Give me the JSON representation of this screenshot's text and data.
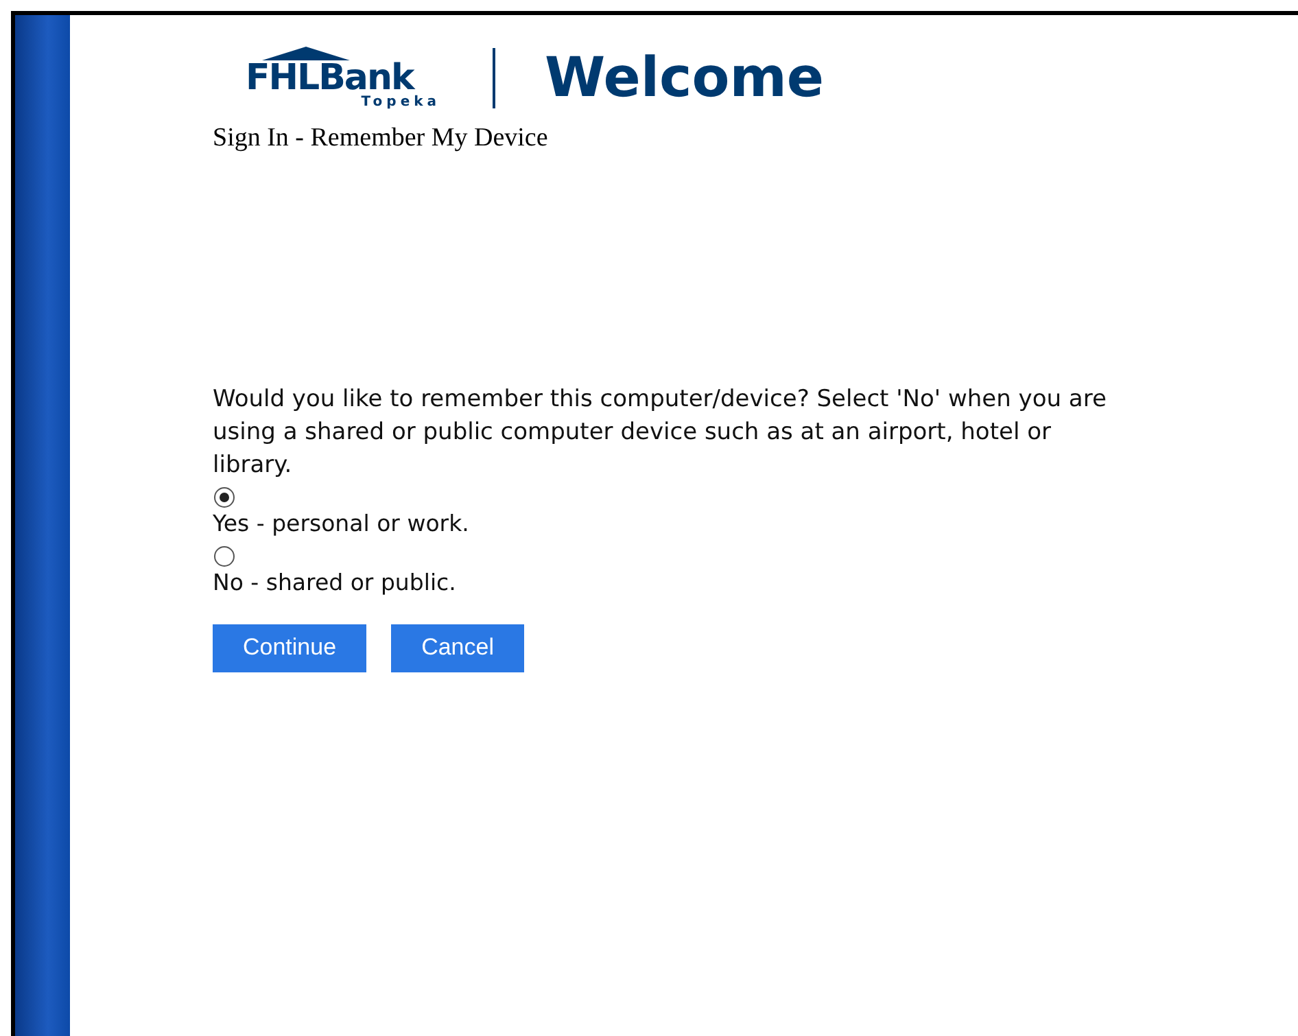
{
  "logo": {
    "name": "FHLBank",
    "subtitle": "Topeka"
  },
  "welcome": "Welcome",
  "heading": "Sign In - Remember My Device",
  "question": "Would you like to remember this computer/device? Select 'No' when you are using a shared or public computer device such as at an airport, hotel or library.",
  "options": [
    {
      "label": "Yes - personal or work.",
      "selected": true
    },
    {
      "label": "No - shared or public.",
      "selected": false
    }
  ],
  "buttons": [
    "Continue",
    "Cancel"
  ]
}
